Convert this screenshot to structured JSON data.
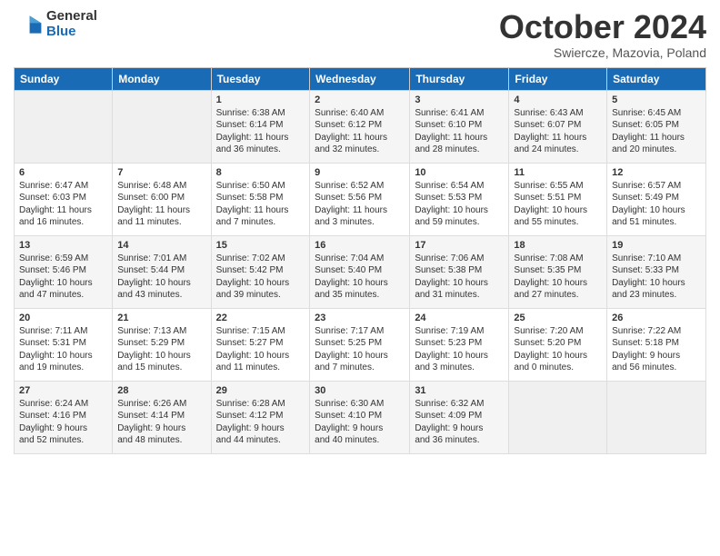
{
  "logo": {
    "general": "General",
    "blue": "Blue"
  },
  "title": "October 2024",
  "location": "Swiercze, Mazovia, Poland",
  "headers": [
    "Sunday",
    "Monday",
    "Tuesday",
    "Wednesday",
    "Thursday",
    "Friday",
    "Saturday"
  ],
  "weeks": [
    [
      {
        "day": "",
        "info": ""
      },
      {
        "day": "",
        "info": ""
      },
      {
        "day": "1",
        "info": "Sunrise: 6:38 AM\nSunset: 6:14 PM\nDaylight: 11 hours\nand 36 minutes."
      },
      {
        "day": "2",
        "info": "Sunrise: 6:40 AM\nSunset: 6:12 PM\nDaylight: 11 hours\nand 32 minutes."
      },
      {
        "day": "3",
        "info": "Sunrise: 6:41 AM\nSunset: 6:10 PM\nDaylight: 11 hours\nand 28 minutes."
      },
      {
        "day": "4",
        "info": "Sunrise: 6:43 AM\nSunset: 6:07 PM\nDaylight: 11 hours\nand 24 minutes."
      },
      {
        "day": "5",
        "info": "Sunrise: 6:45 AM\nSunset: 6:05 PM\nDaylight: 11 hours\nand 20 minutes."
      }
    ],
    [
      {
        "day": "6",
        "info": "Sunrise: 6:47 AM\nSunset: 6:03 PM\nDaylight: 11 hours\nand 16 minutes."
      },
      {
        "day": "7",
        "info": "Sunrise: 6:48 AM\nSunset: 6:00 PM\nDaylight: 11 hours\nand 11 minutes."
      },
      {
        "day": "8",
        "info": "Sunrise: 6:50 AM\nSunset: 5:58 PM\nDaylight: 11 hours\nand 7 minutes."
      },
      {
        "day": "9",
        "info": "Sunrise: 6:52 AM\nSunset: 5:56 PM\nDaylight: 11 hours\nand 3 minutes."
      },
      {
        "day": "10",
        "info": "Sunrise: 6:54 AM\nSunset: 5:53 PM\nDaylight: 10 hours\nand 59 minutes."
      },
      {
        "day": "11",
        "info": "Sunrise: 6:55 AM\nSunset: 5:51 PM\nDaylight: 10 hours\nand 55 minutes."
      },
      {
        "day": "12",
        "info": "Sunrise: 6:57 AM\nSunset: 5:49 PM\nDaylight: 10 hours\nand 51 minutes."
      }
    ],
    [
      {
        "day": "13",
        "info": "Sunrise: 6:59 AM\nSunset: 5:46 PM\nDaylight: 10 hours\nand 47 minutes."
      },
      {
        "day": "14",
        "info": "Sunrise: 7:01 AM\nSunset: 5:44 PM\nDaylight: 10 hours\nand 43 minutes."
      },
      {
        "day": "15",
        "info": "Sunrise: 7:02 AM\nSunset: 5:42 PM\nDaylight: 10 hours\nand 39 minutes."
      },
      {
        "day": "16",
        "info": "Sunrise: 7:04 AM\nSunset: 5:40 PM\nDaylight: 10 hours\nand 35 minutes."
      },
      {
        "day": "17",
        "info": "Sunrise: 7:06 AM\nSunset: 5:38 PM\nDaylight: 10 hours\nand 31 minutes."
      },
      {
        "day": "18",
        "info": "Sunrise: 7:08 AM\nSunset: 5:35 PM\nDaylight: 10 hours\nand 27 minutes."
      },
      {
        "day": "19",
        "info": "Sunrise: 7:10 AM\nSunset: 5:33 PM\nDaylight: 10 hours\nand 23 minutes."
      }
    ],
    [
      {
        "day": "20",
        "info": "Sunrise: 7:11 AM\nSunset: 5:31 PM\nDaylight: 10 hours\nand 19 minutes."
      },
      {
        "day": "21",
        "info": "Sunrise: 7:13 AM\nSunset: 5:29 PM\nDaylight: 10 hours\nand 15 minutes."
      },
      {
        "day": "22",
        "info": "Sunrise: 7:15 AM\nSunset: 5:27 PM\nDaylight: 10 hours\nand 11 minutes."
      },
      {
        "day": "23",
        "info": "Sunrise: 7:17 AM\nSunset: 5:25 PM\nDaylight: 10 hours\nand 7 minutes."
      },
      {
        "day": "24",
        "info": "Sunrise: 7:19 AM\nSunset: 5:23 PM\nDaylight: 10 hours\nand 3 minutes."
      },
      {
        "day": "25",
        "info": "Sunrise: 7:20 AM\nSunset: 5:20 PM\nDaylight: 10 hours\nand 0 minutes."
      },
      {
        "day": "26",
        "info": "Sunrise: 7:22 AM\nSunset: 5:18 PM\nDaylight: 9 hours\nand 56 minutes."
      }
    ],
    [
      {
        "day": "27",
        "info": "Sunrise: 6:24 AM\nSunset: 4:16 PM\nDaylight: 9 hours\nand 52 minutes."
      },
      {
        "day": "28",
        "info": "Sunrise: 6:26 AM\nSunset: 4:14 PM\nDaylight: 9 hours\nand 48 minutes."
      },
      {
        "day": "29",
        "info": "Sunrise: 6:28 AM\nSunset: 4:12 PM\nDaylight: 9 hours\nand 44 minutes."
      },
      {
        "day": "30",
        "info": "Sunrise: 6:30 AM\nSunset: 4:10 PM\nDaylight: 9 hours\nand 40 minutes."
      },
      {
        "day": "31",
        "info": "Sunrise: 6:32 AM\nSunset: 4:09 PM\nDaylight: 9 hours\nand 36 minutes."
      },
      {
        "day": "",
        "info": ""
      },
      {
        "day": "",
        "info": ""
      }
    ]
  ]
}
